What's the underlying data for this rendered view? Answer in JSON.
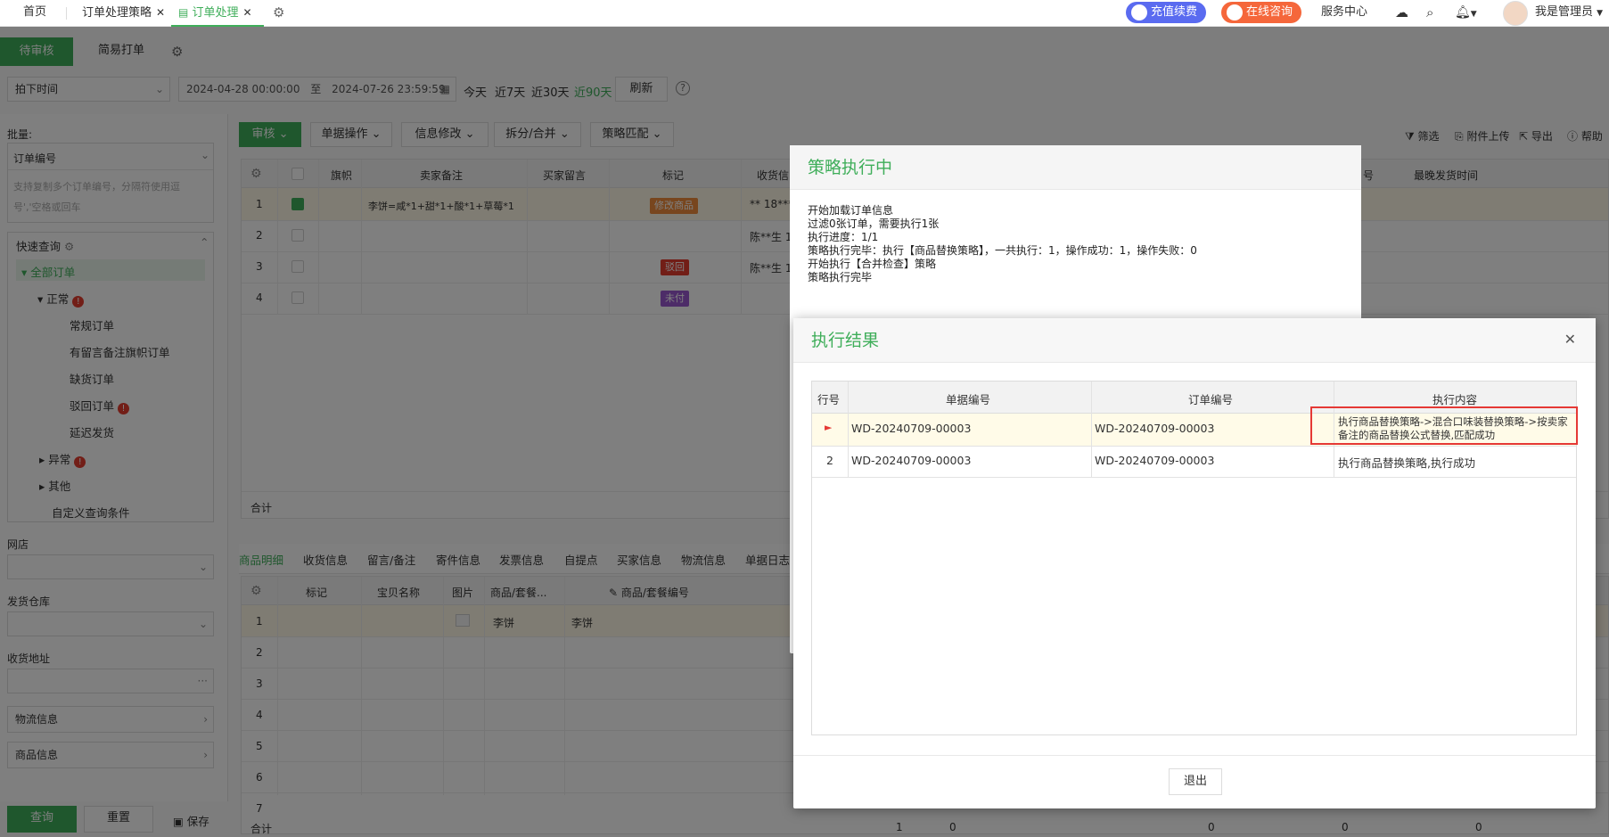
{
  "tabs": [
    {
      "label": "首页",
      "closable": false
    },
    {
      "label": "订单处理策略",
      "closable": true
    },
    {
      "label": "订单处理",
      "closable": true,
      "active": true
    }
  ],
  "header": {
    "recharge": "充值续费",
    "consult": "在线咨询",
    "service": "服务中心",
    "user": "我是管理员"
  },
  "colors": {
    "accent": "#3fae5a",
    "recharge": "#5a6bf0",
    "consult": "#f5673b",
    "highlight_box": "#e53935"
  },
  "toolbar": {
    "tab_pending": "待审核",
    "tab_simple": "简易打单",
    "time_type": "拍下时间",
    "date_from": "2024-04-28 00:00:00",
    "date_sep": "至",
    "date_to": "2024-07-26 23:59:59",
    "quick_today": "今天",
    "quick_7": "近7天",
    "quick_30": "近30天",
    "quick_90": "近90天",
    "refresh": "刷新"
  },
  "sidebar": {
    "batch_label": "批量:",
    "batch_field": "订单编号",
    "batch_placeholder": "支持复制多个订单编号，分隔符使用逗号','空格或回车",
    "quick_query": "快速查询",
    "tree": {
      "all": "全部订单",
      "normal": "正常",
      "regular": "常规订单",
      "flagged": "有留言备注旗帜订单",
      "shortage": "缺货订单",
      "rejected": "驳回订单",
      "delayed": "延迟发货",
      "abnormal": "异常",
      "other": "其他",
      "custom": "自定义查询条件"
    },
    "shop_label": "网店",
    "warehouse_label": "发货仓库",
    "address_label": "收货地址",
    "logistics": "物流信息",
    "goods": "商品信息",
    "query_btn": "查询",
    "reset_btn": "重置",
    "save_btn": "保存"
  },
  "actions": {
    "audit": "审核",
    "single": "单据操作",
    "info": "信息修改",
    "split": "拆分/合并",
    "strategy": "策略匹配",
    "filter": "筛选",
    "attach": "附件上传",
    "export": "导出",
    "help": "帮助"
  },
  "order_grid": {
    "headers": [
      "旗帜",
      "卖家备注",
      "买家留言",
      "标记",
      "收货信",
      "号",
      "最晚发货时间"
    ],
    "rows": [
      {
        "no": "1",
        "seller_note": "李饼=咸*1+甜*1+酸*1+草莓*1",
        "tag": "修改商品",
        "receiver": "** 18***",
        "checked": true
      },
      {
        "no": "2",
        "seller_note": "",
        "tag": "",
        "receiver": "陈**生 1",
        "checked": false
      },
      {
        "no": "3",
        "seller_note": "",
        "tag": "驳回",
        "receiver": "陈**生 1",
        "checked": false
      },
      {
        "no": "4",
        "seller_note": "",
        "tag": "未付",
        "receiver": "",
        "checked": false
      }
    ],
    "total_label": "合计"
  },
  "detail_tabs": [
    "商品明细",
    "收货信息",
    "留言/备注",
    "寄件信息",
    "发票信息",
    "自提点",
    "买家信息",
    "物流信息",
    "单据日志"
  ],
  "detail_grid": {
    "headers": [
      "标记",
      "宝贝名称",
      "图片",
      "商品/套餐...",
      "商品/套餐编号"
    ],
    "row1": {
      "code": "李饼",
      "name": "李饼"
    },
    "row_numbers": [
      "1",
      "2",
      "3",
      "4",
      "5",
      "6",
      "7"
    ],
    "total_label": "合计",
    "totals": [
      "1",
      "0",
      "0",
      "0",
      "0"
    ]
  },
  "dialog_strategy": {
    "title": "策略执行中",
    "log": [
      "开始加载订单信息",
      "过滤0张订单，需要执行1张",
      "执行进度：1/1",
      "策略执行完毕：执行【商品替换策略】，一共执行：1，操作成功：1，操作失败：0",
      "开始执行【合并检查】策略",
      "策略执行完毕"
    ]
  },
  "dialog_result": {
    "title": "执行结果",
    "headers": {
      "row": "行号",
      "doc": "单据编号",
      "order": "订单编号",
      "content": "执行内容"
    },
    "rows": [
      {
        "row": "",
        "doc": "WD-20240709-00003",
        "order": "WD-20240709-00003",
        "content": "执行商品替换策略->混合口味装替换策略->按卖家备注的商品替换公式替换,匹配成功"
      },
      {
        "row": "2",
        "doc": "WD-20240709-00003",
        "order": "WD-20240709-00003",
        "content": "执行商品替换策略,执行成功"
      }
    ],
    "exit": "退出"
  }
}
